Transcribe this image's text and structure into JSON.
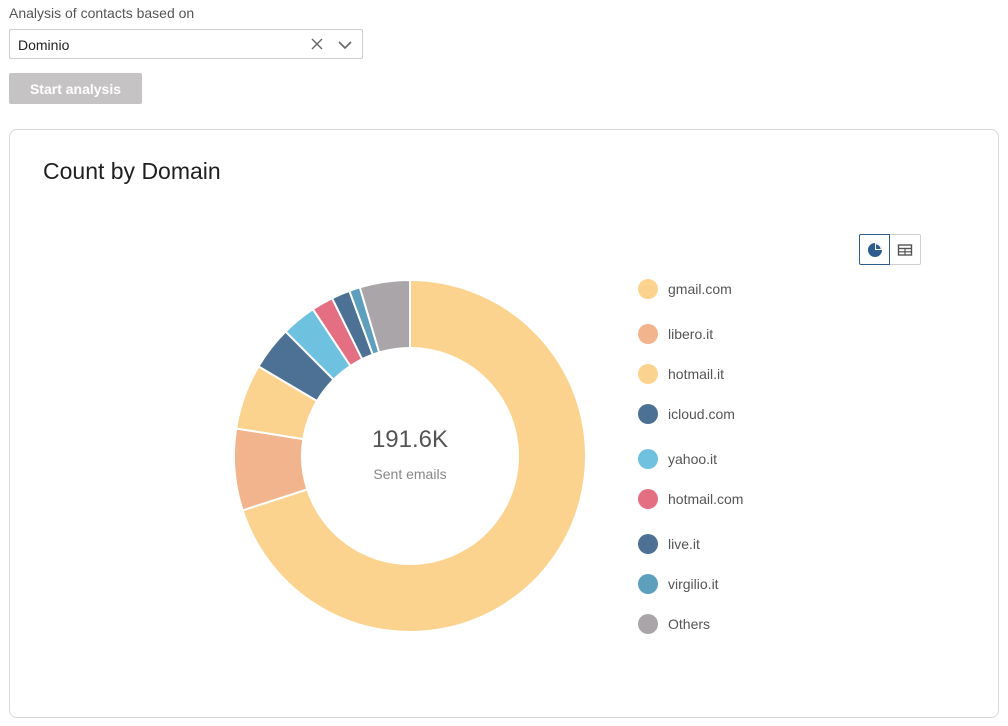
{
  "form": {
    "label": "Analysis of contacts based on",
    "select_value": "Dominio",
    "clear_icon": "close-icon",
    "chevron_icon": "chevron-down-icon",
    "start_label": "Start analysis"
  },
  "card": {
    "title": "Count by Domain",
    "toggle": {
      "pie_icon": "pie-chart-icon",
      "table_icon": "table-icon",
      "active": "pie"
    }
  },
  "chart_data": {
    "type": "pie",
    "title": "Count by Domain",
    "center_value": "191.6K",
    "center_label": "Sent emails",
    "legend_position": "right",
    "slices": [
      {
        "label": "gmail.com",
        "value": 70.0,
        "color": "#fbd38f"
      },
      {
        "label": "libero.it",
        "value": 7.5,
        "color": "#f1b48c"
      },
      {
        "label": "hotmail.it",
        "value": 6.0,
        "color": "#fbd38f"
      },
      {
        "label": "icloud.com",
        "value": 4.0,
        "color": "#4c7194"
      },
      {
        "label": "yahoo.it",
        "value": 3.2,
        "color": "#6ec1df"
      },
      {
        "label": "hotmail.com",
        "value": 2.0,
        "color": "#e46e82"
      },
      {
        "label": "live.it",
        "value": 1.7,
        "color": "#4c7194"
      },
      {
        "label": "virgilio.it",
        "value": 1.0,
        "color": "#5d9fbc"
      },
      {
        "label": "Others",
        "value": 4.6,
        "color": "#aaa5a8"
      }
    ]
  }
}
